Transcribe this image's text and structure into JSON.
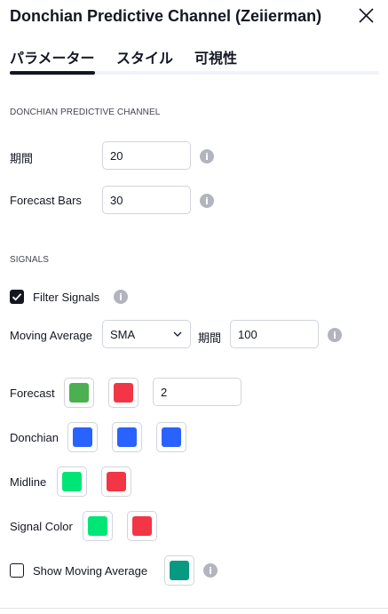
{
  "dialog": {
    "title": "Donchian Predictive Channel (Zeiierman)",
    "tabs": [
      {
        "label": "パラメーター",
        "active": true
      },
      {
        "label": "スタイル",
        "active": false
      },
      {
        "label": "可視性",
        "active": false
      }
    ]
  },
  "sections": {
    "donchian": {
      "heading": "DONCHIAN PREDICTIVE CHANNEL",
      "period_label": "期間",
      "period_value": "20",
      "forecast_bars_label": "Forecast Bars",
      "forecast_bars_value": "30"
    },
    "signals": {
      "heading": "SIGNALS",
      "filter_signals_label": "Filter Signals",
      "filter_signals_checked": true,
      "moving_average_label": "Moving Average",
      "moving_average_value": "SMA",
      "ma_period_label": "期間",
      "ma_period_value": "100"
    }
  },
  "colors": {
    "forecast": {
      "label": "Forecast",
      "swatches": [
        "#4caf50",
        "#f23645"
      ],
      "width_value": "2"
    },
    "donchian": {
      "label": "Donchian",
      "swatches": [
        "#2962ff",
        "#2962ff",
        "#2962ff"
      ]
    },
    "midline": {
      "label": "Midline",
      "swatches": [
        "#00e676",
        "#f23645"
      ]
    },
    "signal_color": {
      "label": "Signal Color",
      "swatches": [
        "#00e676",
        "#f23645"
      ]
    },
    "show_ma": {
      "label": "Show Moving Average",
      "checked": false,
      "swatch": "#089981"
    }
  },
  "icons": {
    "close": "close-icon",
    "info": "info-icon",
    "chevron": "chevron-down-icon",
    "check": "checkmark-icon"
  }
}
